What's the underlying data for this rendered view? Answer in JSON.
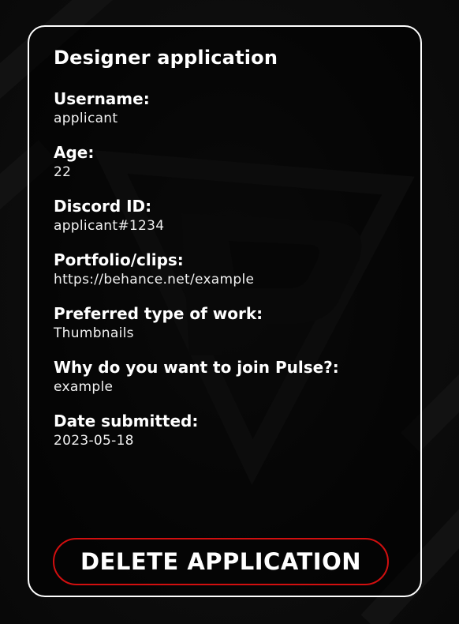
{
  "card": {
    "title": "Designer application",
    "fields": [
      {
        "label": "Username:",
        "value": "applicant"
      },
      {
        "label": "Age:",
        "value": "22"
      },
      {
        "label": "Discord ID:",
        "value": "applicant#1234"
      },
      {
        "label": "Portfolio/clips:",
        "value": "https://behance.net/example"
      },
      {
        "label": "Preferred type of work:",
        "value": "Thumbnails"
      },
      {
        "label": "Why do you want to join Pulse?:",
        "value": "example"
      },
      {
        "label": "Date submitted:",
        "value": "2023-05-18"
      }
    ],
    "delete_label": "DELETE APPLICATION"
  },
  "colors": {
    "background": "#0b0b0b",
    "card_border": "#ffffff",
    "delete_border": "#d10f0f",
    "text": "#ffffff"
  },
  "background_logo": "pulse-logo-watermark"
}
